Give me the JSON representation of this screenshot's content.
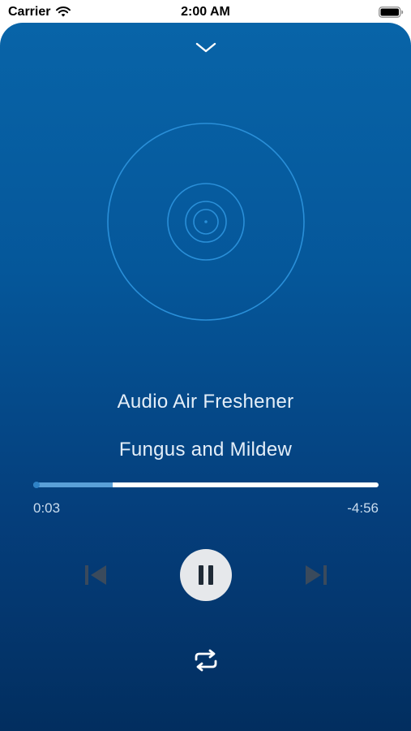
{
  "status_bar": {
    "carrier": "Carrier",
    "time": "2:00 AM",
    "wifi_icon": "wifi-icon",
    "battery_icon": "battery-icon"
  },
  "player": {
    "collapse_icon": "chevron-down-icon",
    "artwork_icon": "disc-icon",
    "track_title": "Audio Air Freshener",
    "track_artist": "Fungus and Mildew",
    "progress_fraction": 0.23,
    "elapsed_time": "0:03",
    "remaining_time": "-4:56",
    "is_playing": true,
    "controls": {
      "previous_icon": "skip-back-icon",
      "play_pause_icon": "pause-icon",
      "next_icon": "skip-forward-icon",
      "repeat_icon": "repeat-icon"
    }
  },
  "colors": {
    "background_top": "#0864a8",
    "background_bottom": "#022e5f",
    "progress_fill": "#5aa0d8",
    "progress_track": "#ffffff",
    "text": "#e4eef8"
  }
}
